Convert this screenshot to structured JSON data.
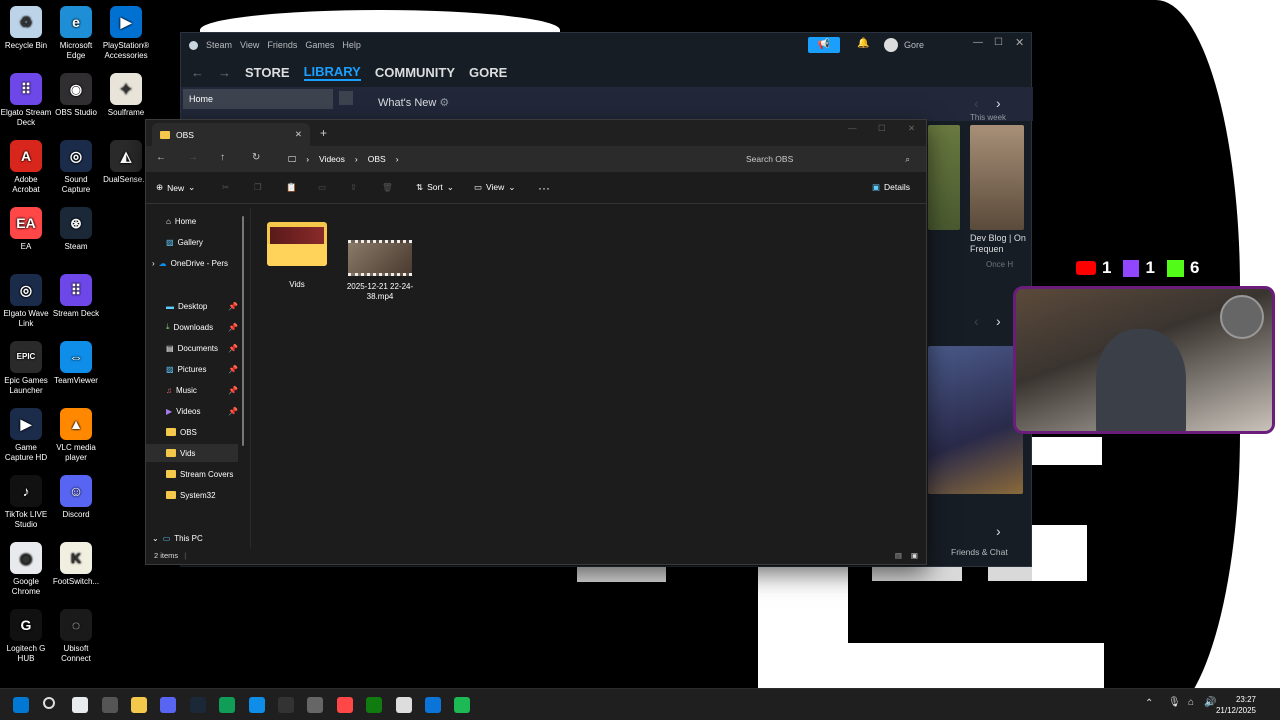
{
  "desktop": {
    "icons": [
      {
        "label": "Recycle Bin",
        "color": "#bcd3e8",
        "glyph": "♻"
      },
      {
        "label": "Microsoft Edge",
        "color": "#1e8fd6",
        "glyph": "e"
      },
      {
        "label": "PlayStation® Accessories",
        "color": "#0070d1",
        "glyph": "▶"
      },
      {
        "label": "Elgato Stream Deck",
        "color": "#6e47e8",
        "glyph": "⠿"
      },
      {
        "label": "OBS Studio",
        "color": "#302e31",
        "glyph": "◉"
      },
      {
        "label": "Soulframe",
        "color": "#e8e4da",
        "glyph": "✦"
      },
      {
        "label": "Adobe Acrobat",
        "color": "#d9261c",
        "glyph": "A"
      },
      {
        "label": "Sound Capture",
        "color": "#1b2b4a",
        "glyph": "◎"
      },
      {
        "label": "DualSense...",
        "color": "#2b2b2b",
        "glyph": "◭"
      },
      {
        "label": "EA",
        "color": "#ff4747",
        "glyph": "EA"
      },
      {
        "label": "Steam",
        "color": "#1b2838",
        "glyph": "⊛"
      },
      {
        "label": "Elgato Wave Link",
        "color": "#1b2b4a",
        "glyph": "◎"
      },
      {
        "label": "Stream Deck",
        "color": "#6e47e8",
        "glyph": "⠿"
      },
      {
        "label": "Epic Games Launcher",
        "color": "#2a2a2a",
        "glyph": "EPIC"
      },
      {
        "label": "TeamViewer",
        "color": "#0e8ee9",
        "glyph": "⇔"
      },
      {
        "label": "Game Capture HD",
        "color": "#1b2b4a",
        "glyph": "▶"
      },
      {
        "label": "VLC media player",
        "color": "#ff8800",
        "glyph": "▲"
      },
      {
        "label": "TikTok LIVE Studio",
        "color": "#111111",
        "glyph": "♪"
      },
      {
        "label": "Discord",
        "color": "#5865f2",
        "glyph": "☺"
      },
      {
        "label": "Google Chrome",
        "color": "#e8eaed",
        "glyph": "◉"
      },
      {
        "label": "FootSwitch...",
        "color": "#f1efe0",
        "glyph": "K"
      },
      {
        "label": "Logitech G HUB",
        "color": "#111111",
        "glyph": "G"
      },
      {
        "label": "Ubisoft Connect",
        "color": "#1a1a1a",
        "glyph": "◌"
      }
    ]
  },
  "steam": {
    "menu": [
      "Steam",
      "View",
      "Friends",
      "Games",
      "Help"
    ],
    "nav": [
      "STORE",
      "LIBRARY",
      "COMMUNITY",
      "GORE"
    ],
    "user": "Gore",
    "home_tab": "Home",
    "whats_new": "What's New",
    "this_week": "This week",
    "dev_blog": "Dev Blog | On Frequen",
    "once_h": "Once H",
    "friends_chat": "Friends & Chat",
    "colors": {
      "bg": "#171d25",
      "accent": "#1a9fff"
    }
  },
  "explorer": {
    "tab_title": "OBS",
    "breadcrumb": [
      "Videos",
      "OBS"
    ],
    "search_placeholder": "Search OBS",
    "toolbar": {
      "new": "New",
      "sort": "Sort",
      "view": "View",
      "details": "Details"
    },
    "sidebar": {
      "home": "Home",
      "gallery": "Gallery",
      "onedrive": "OneDrive - Pers",
      "desktop": "Desktop",
      "downloads": "Downloads",
      "documents": "Documents",
      "pictures": "Pictures",
      "music": "Music",
      "videos": "Videos",
      "obs": "OBS",
      "vids": "Vids",
      "stream_covers": "Stream Covers",
      "system32": "System32",
      "this_pc": "This PC"
    },
    "files": [
      {
        "name": "Vids",
        "type": "folder"
      },
      {
        "name": "2025-12-21 22-24-38.mp4",
        "type": "video"
      }
    ],
    "status": "2 items"
  },
  "overlay": {
    "youtube_count": "1",
    "twitch_count": "1",
    "kick_count": "6",
    "colors": {
      "youtube": "#ff0000",
      "twitch": "#9146ff",
      "kick": "#53fc18"
    }
  },
  "taskbar": {
    "time": "23:27",
    "date": "21/12/2025"
  }
}
